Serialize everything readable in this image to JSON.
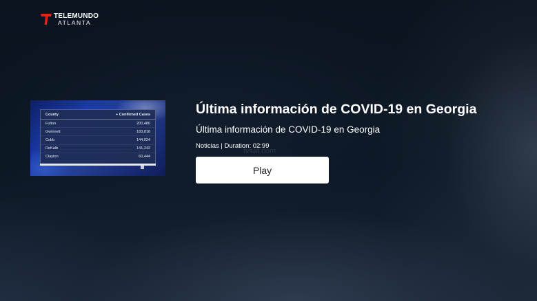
{
  "brand": {
    "line1": "TELEMUNDO",
    "line2": "ATLANTA",
    "logo_icon": "telemundo-t-icon",
    "accent_color": "#e2231a"
  },
  "thumbnail": {
    "header": {
      "county": "County",
      "cases": "+ Confirmed Cases"
    },
    "rows": [
      {
        "county": "Fulton",
        "cases": "200,480"
      },
      {
        "county": "Gwinnett",
        "cases": "183,818"
      },
      {
        "county": "Cobb",
        "cases": "144,024"
      },
      {
        "county": "DeKalb",
        "cases": "141,242"
      },
      {
        "county": "Clayton",
        "cases": "60,444"
      }
    ]
  },
  "detail": {
    "title": "Última información de COVID-19 en Georgia",
    "description": "Última información de COVID-19 en Georgia",
    "meta": "Noticias | Duration: 02:99",
    "watermark": "tvsat.com"
  },
  "actions": {
    "play_label": "Play"
  },
  "colors": {
    "background": "#0a1320",
    "button_bg": "#ffffff",
    "button_text": "#222222",
    "thumbnail_blue": "#1b3aa8"
  }
}
